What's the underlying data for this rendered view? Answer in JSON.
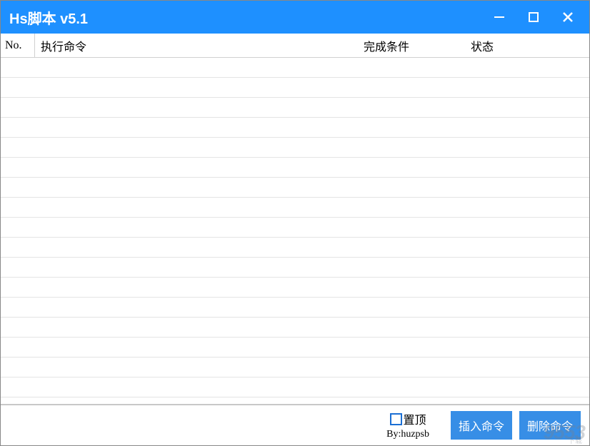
{
  "titlebar": {
    "title": "Hs脚本 v5.1"
  },
  "table": {
    "headers": {
      "no": "No.",
      "command": "执行命令",
      "condition": "完成条件",
      "status": "状态"
    },
    "row_count": 17
  },
  "footer": {
    "topmost_label": "置顶",
    "byline": "By:huzpsb",
    "insert_button": "插入命令",
    "delete_button": "删除命令"
  },
  "watermark": {
    "main": "9553",
    "sub": "下载"
  },
  "colors": {
    "accent": "#1e90ff",
    "button": "#378ee6"
  }
}
